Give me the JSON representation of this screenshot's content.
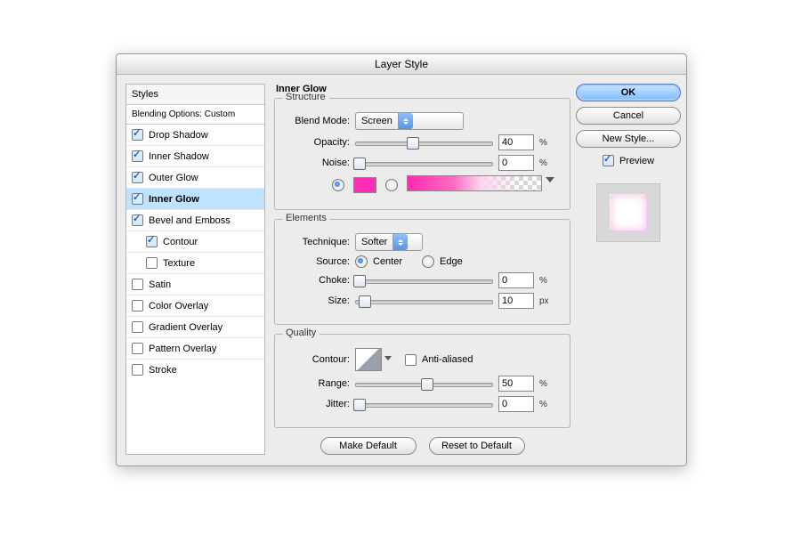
{
  "window": {
    "title": "Layer Style"
  },
  "styles": {
    "header": "Styles",
    "blending": "Blending Options: Custom",
    "items": [
      {
        "label": "Drop Shadow",
        "checked": true,
        "selected": false,
        "indent": false
      },
      {
        "label": "Inner Shadow",
        "checked": true,
        "selected": false,
        "indent": false
      },
      {
        "label": "Outer Glow",
        "checked": true,
        "selected": false,
        "indent": false
      },
      {
        "label": "Inner Glow",
        "checked": true,
        "selected": true,
        "indent": false
      },
      {
        "label": "Bevel and Emboss",
        "checked": true,
        "selected": false,
        "indent": false
      },
      {
        "label": "Contour",
        "checked": true,
        "selected": false,
        "indent": true
      },
      {
        "label": "Texture",
        "checked": false,
        "selected": false,
        "indent": true
      },
      {
        "label": "Satin",
        "checked": false,
        "selected": false,
        "indent": false
      },
      {
        "label": "Color Overlay",
        "checked": false,
        "selected": false,
        "indent": false
      },
      {
        "label": "Gradient Overlay",
        "checked": false,
        "selected": false,
        "indent": false
      },
      {
        "label": "Pattern Overlay",
        "checked": false,
        "selected": false,
        "indent": false
      },
      {
        "label": "Stroke",
        "checked": false,
        "selected": false,
        "indent": false
      }
    ]
  },
  "panel": {
    "title": "Inner Glow",
    "structure": {
      "legend": "Structure",
      "blend_mode_label": "Blend Mode:",
      "blend_mode_value": "Screen",
      "opacity_label": "Opacity:",
      "opacity_value": "40",
      "opacity_unit": "%",
      "noise_label": "Noise:",
      "noise_value": "0",
      "noise_unit": "%",
      "color_selected": true,
      "swatch_color": "#ff29b0"
    },
    "elements": {
      "legend": "Elements",
      "technique_label": "Technique:",
      "technique_value": "Softer",
      "source_label": "Source:",
      "source_center": "Center",
      "source_edge": "Edge",
      "source_value": "center",
      "choke_label": "Choke:",
      "choke_value": "0",
      "choke_unit": "%",
      "size_label": "Size:",
      "size_value": "10",
      "size_unit": "px"
    },
    "quality": {
      "legend": "Quality",
      "contour_label": "Contour:",
      "aa_label": "Anti-aliased",
      "aa_checked": false,
      "range_label": "Range:",
      "range_value": "50",
      "range_unit": "%",
      "jitter_label": "Jitter:",
      "jitter_value": "0",
      "jitter_unit": "%"
    },
    "make_default": "Make Default",
    "reset_default": "Reset to Default"
  },
  "right": {
    "ok": "OK",
    "cancel": "Cancel",
    "new_style": "New Style...",
    "preview_label": "Preview",
    "preview_checked": true
  }
}
